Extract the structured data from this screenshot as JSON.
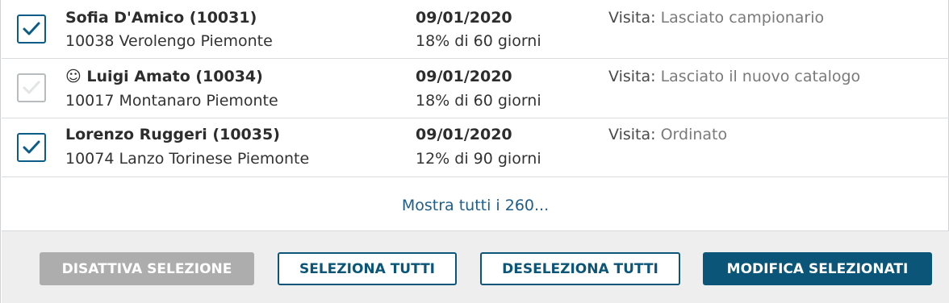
{
  "rows": [
    {
      "checked": true,
      "name": "Sofia D'Amico (10031)",
      "address": "10038 Verolengo Piemonte",
      "date": "09/01/2020",
      "terms": "18% di 60 giorni",
      "visit_label": "Visita:",
      "visit_value": "Lasciato campionario"
    },
    {
      "checked": false,
      "name": "☺ Luigi Amato (10034)",
      "address": "10017 Montanaro Piemonte",
      "date": "09/01/2020",
      "terms": "18% di 60 giorni",
      "visit_label": "Visita:",
      "visit_value": "Lasciato il nuovo catalogo"
    },
    {
      "checked": true,
      "name": "Lorenzo Ruggeri (10035)",
      "address": "10074 Lanzo Torinese Piemonte",
      "date": "09/01/2020",
      "terms": "12% di 90 giorni",
      "visit_label": "Visita:",
      "visit_value": "Ordinato"
    }
  ],
  "show_all": "Mostra tutti i 260...",
  "buttons": {
    "deactivate": "DISATTIVA SELEZIONE",
    "select_all": "SELEZIONA TUTTI",
    "deselect_all": "DESELEZIONA TUTTI",
    "edit_selected": "MODIFICA SELEZIONATI"
  },
  "colors": {
    "accent": "#0b5578",
    "link": "#1d5f8a",
    "disabled": "#adadad",
    "footer_bg": "#eeeeee"
  }
}
